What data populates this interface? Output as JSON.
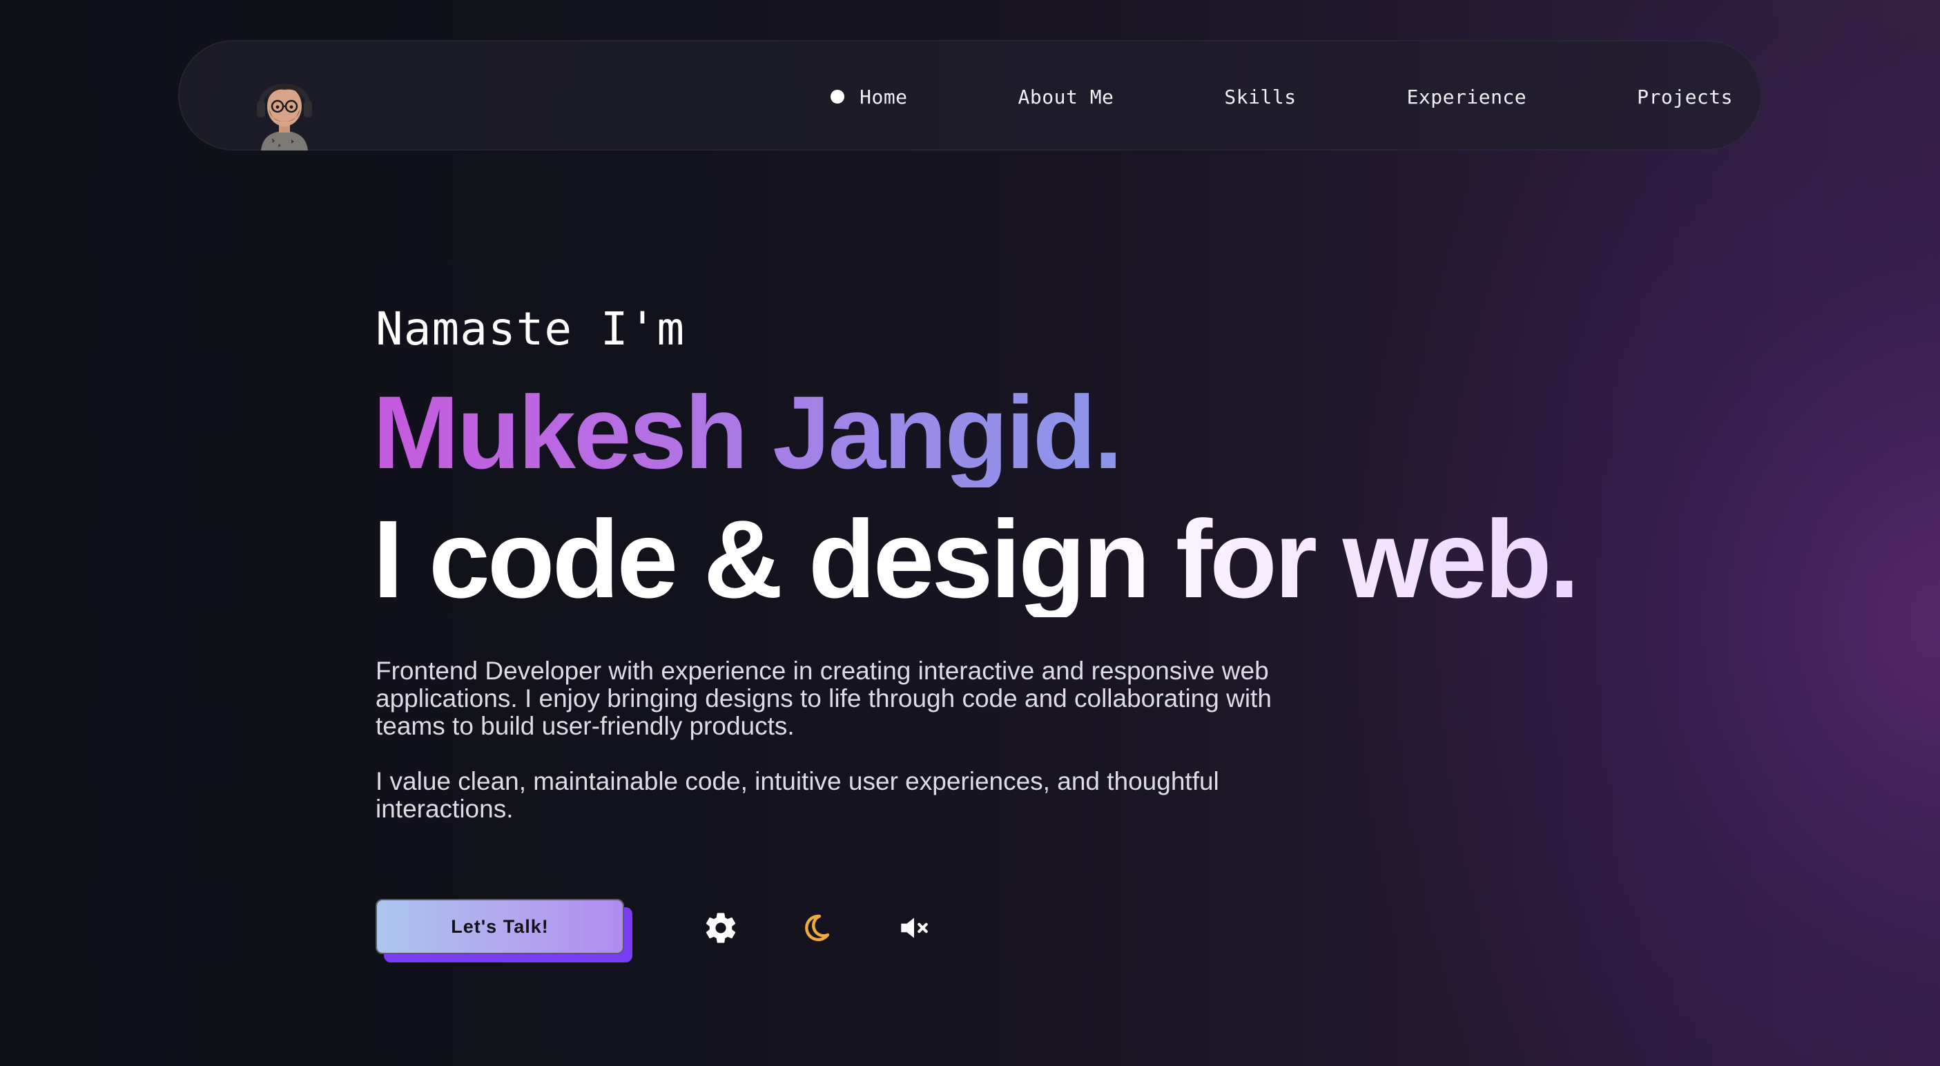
{
  "nav": {
    "avatar_alt": "avatar",
    "items": [
      {
        "label": "Home",
        "active": true
      },
      {
        "label": "About Me"
      },
      {
        "label": "Skills"
      },
      {
        "label": "Experience"
      },
      {
        "label": "Projects"
      }
    ]
  },
  "hero": {
    "greeting": "Namaste I'm",
    "name": "Mukesh Jangid.",
    "tagline": "I code & design for web.",
    "bio_1": "Frontend Developer with experience in creating interactive and responsive web applications. I enjoy bringing designs to life through code and collaborating with teams to build user-friendly products.",
    "bio_2": "I value clean, maintainable code, intuitive user experiences, and thoughtful interactions."
  },
  "actions": {
    "cta_label": "Let's Talk!",
    "icons": [
      "gear-icon",
      "moon-icon",
      "speaker-muted-icon"
    ]
  },
  "colors": {
    "name_gradient_start": "#c65ade",
    "name_gradient_end": "#8b96ea",
    "cta_shadow": "#7a3cf2",
    "moon": "#f0a93b"
  }
}
